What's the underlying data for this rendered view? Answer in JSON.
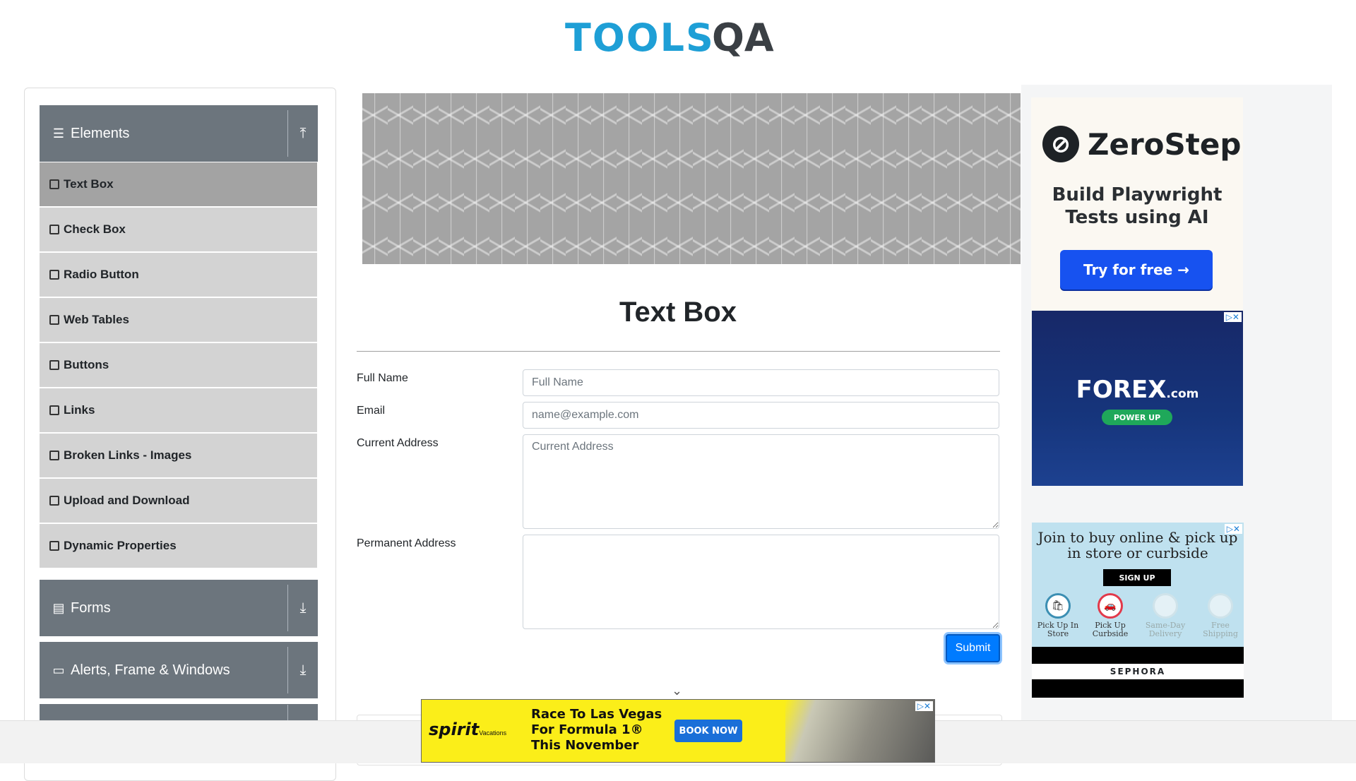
{
  "header": {
    "logo_tools": "TOOLS",
    "logo_qa": "QA"
  },
  "sidebar": {
    "groups": [
      {
        "label": "Elements",
        "icon": "hamburger-icon",
        "toggle_icon": "arrow-up-icon"
      },
      {
        "label": "Forms",
        "icon": "document-icon",
        "toggle_icon": "arrow-down-icon"
      },
      {
        "label": "Alerts, Frame & Windows",
        "icon": "window-icon",
        "toggle_icon": "arrow-down-icon"
      }
    ],
    "items": [
      {
        "label": "Text Box",
        "active": true
      },
      {
        "label": "Check Box"
      },
      {
        "label": "Radio Button"
      },
      {
        "label": "Web Tables"
      },
      {
        "label": "Buttons"
      },
      {
        "label": "Links"
      },
      {
        "label": "Broken Links - Images"
      },
      {
        "label": "Upload and Download"
      },
      {
        "label": "Dynamic Properties"
      }
    ]
  },
  "main": {
    "title": "Text Box",
    "fields": {
      "full_name": {
        "label": "Full Name",
        "placeholder": "Full Name",
        "value": ""
      },
      "email": {
        "label": "Email",
        "placeholder": "name@example.com",
        "value": ""
      },
      "current_address": {
        "label": "Current Address",
        "placeholder": "Current Address",
        "value": ""
      },
      "permanent_address": {
        "label": "Permanent Address",
        "placeholder": "",
        "value": ""
      }
    },
    "submit_label": "Submit"
  },
  "ads": {
    "zerostep": {
      "brand": "ZeroStep",
      "line1": "Build Playwright",
      "line2": "Tests using AI",
      "cta": "Try for free →"
    },
    "forex": {
      "brand_main": "FOREX",
      "brand_suffix": ".com",
      "cta": "POWER UP"
    },
    "sephora": {
      "line1": "Join to buy online & pick up",
      "line2": "in store or curbside",
      "cta": "SIGN UP",
      "options": [
        "Pick Up In Store",
        "Pick Up Curbside",
        "Same-Day Delivery",
        "Free Shipping"
      ],
      "brand": "SEPHORA"
    },
    "spirit": {
      "brand": "spirit",
      "brand_sub": "Vacations",
      "line1": "Race To Las Vegas",
      "line2": "For Formula 1®",
      "line3": "This November",
      "cta": "BOOK NOW"
    },
    "close_marker": "▷✕"
  },
  "colors": {
    "accent": "#007bff",
    "sidebar_header": "#6c757d",
    "menu_item": "#d3d3d3",
    "menu_active": "#a3a3a3",
    "logo_blue": "#1e9fd6"
  }
}
